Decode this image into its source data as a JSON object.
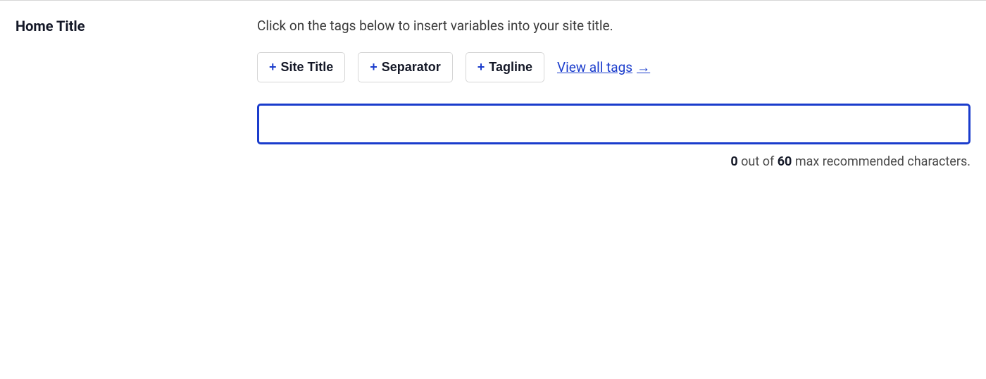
{
  "section": {
    "label": "Home Title"
  },
  "helper": {
    "text": "Click on the tags below to insert variables into your site title."
  },
  "tags": {
    "site_title": "Site Title",
    "separator": "Separator",
    "tagline": "Tagline",
    "view_all": "View all tags",
    "arrow": "→"
  },
  "input": {
    "value": ""
  },
  "counter": {
    "current": "0",
    "middle1": " out of ",
    "max": "60",
    "middle2": " max recommended characters."
  }
}
